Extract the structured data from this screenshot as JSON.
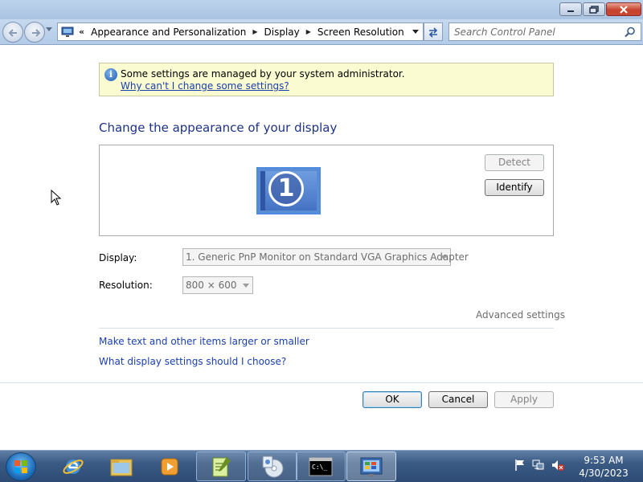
{
  "address": {
    "crumbs": [
      "Appearance and Personalization",
      "Display",
      "Screen Resolution"
    ],
    "overflow": "«"
  },
  "search": {
    "placeholder": "Search Control Panel"
  },
  "info": {
    "message": "Some settings are managed by your system administrator.",
    "link": "Why can't I change some settings?"
  },
  "heading": "Change the appearance of your display",
  "monitor": {
    "number": "1"
  },
  "buttons": {
    "detect": "Detect",
    "identify": "Identify",
    "ok": "OK",
    "cancel": "Cancel",
    "apply": "Apply"
  },
  "fields": {
    "display_label": "Display:",
    "display_value": "1. Generic PnP Monitor on Standard VGA Graphics Adapter",
    "resolution_label": "Resolution:",
    "resolution_value": "800 × 600"
  },
  "advanced_link": "Advanced settings",
  "links": {
    "text_size": "Make text and other items larger or smaller",
    "which_settings": "What display settings should I choose?"
  },
  "taskbar": {
    "time": "9:53 AM",
    "date": "4/30/2023",
    "items": [
      "internet-explorer-icon",
      "file-explorer-icon",
      "media-player-icon",
      "notepad-plus-plus-icon",
      "disc-burner-icon",
      "command-prompt-icon",
      "control-panel-icon"
    ]
  },
  "colors": {
    "link": "#1a3fad",
    "heading": "#1e3287",
    "info_bg": "#fbfbd1"
  }
}
